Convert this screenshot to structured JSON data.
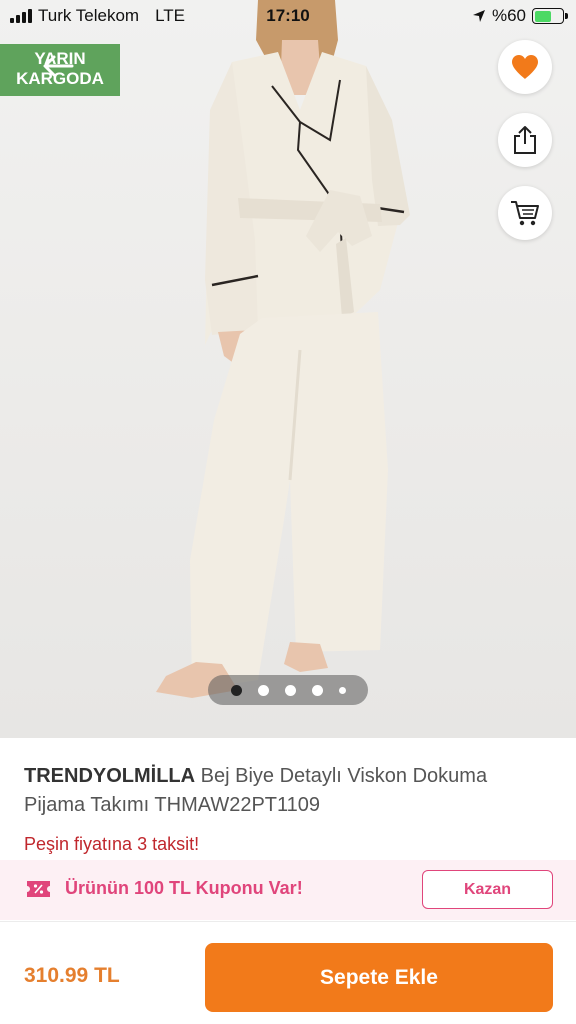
{
  "status_bar": {
    "carrier": "Turk Telekom",
    "network": "LTE",
    "time": "17:10",
    "battery": "%60"
  },
  "badge": {
    "line1": "YARIN",
    "line2": "KARGODA"
  },
  "pager": {
    "count": 5,
    "active_index": 0
  },
  "product": {
    "brand": "TRENDYOLMİLLA",
    "title": " Bej Biye Detaylı Viskon Dokuma Pijama Takımı THMAW22PT1109",
    "installment_text": "Peşin fiyatına 3 taksit!"
  },
  "coupon": {
    "text": "Ürünün 100 TL Kuponu Var!",
    "button_label": "Kazan"
  },
  "bottom_bar": {
    "price": "310.99 TL",
    "add_to_cart_label": "Sepete Ekle"
  },
  "colors": {
    "accent": "#f27a1a",
    "price": "#e57f2e",
    "coupon_pink": "#e0457b",
    "badge_green": "#5fa35c",
    "installment_red": "#c0272d"
  },
  "icons": {
    "favorite": "heart-icon",
    "share": "share-icon",
    "cart": "cart-icon",
    "back": "back-arrow-icon",
    "coupon": "coupon-ticket-icon"
  }
}
